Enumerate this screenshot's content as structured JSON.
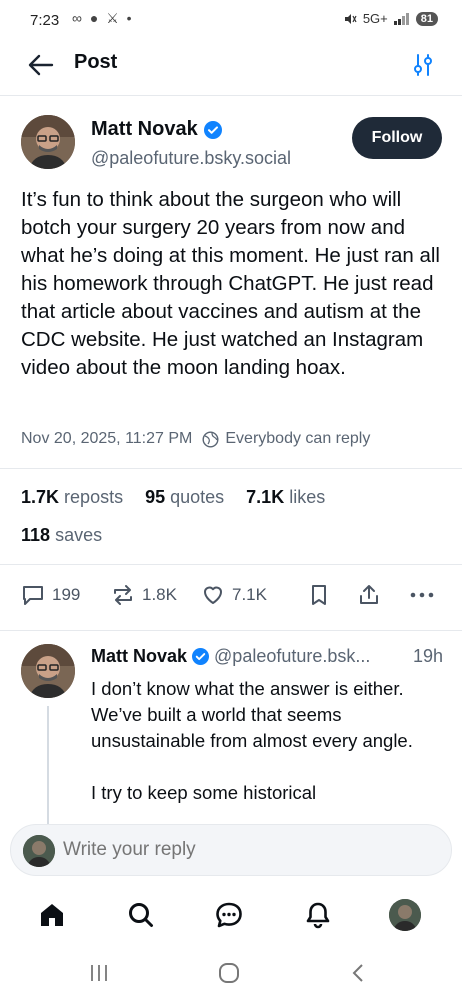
{
  "status_bar": {
    "time": "7:23",
    "left_icons": "∞ ● ⚔ •",
    "signal_text": "5G+",
    "battery": "81"
  },
  "header": {
    "title": "Post"
  },
  "post": {
    "author_name": "Matt Novak",
    "author_handle": "@paleofuture.bsky.social",
    "follow_label": "Follow",
    "text": "It’s fun to think about the surgeon who will botch your surgery 20 years from now and what he’s doing at this moment. He just ran all his homework through ChatGPT. He just read that article about vaccines and autism at the CDC website. He just watched an Instagram video about the moon landing hoax.",
    "timestamp": "Nov 20, 2025, 11:27 PM",
    "reply_setting": "Everybody can reply",
    "stats": {
      "reposts_count": "1.7K",
      "reposts_label": "reposts",
      "quotes_count": "95",
      "quotes_label": "quotes",
      "likes_count": "7.1K",
      "likes_label": "likes",
      "saves_count": "118",
      "saves_label": "saves"
    },
    "actions": {
      "replies": "199",
      "reposts": "1.8K",
      "likes": "7.1K"
    }
  },
  "reply": {
    "author_name": "Matt Novak",
    "author_handle": "@paleofuture.bsk...",
    "time": "19h",
    "text_line1": "I don’t know what the answer is either. We’ve built a world that seems unsustainable from almost every angle.",
    "text_line2": "I try to keep some historical"
  },
  "composer": {
    "placeholder": "Write your reply"
  },
  "colors": {
    "accent": "#1083fe",
    "follow_bg": "#1f2a38",
    "muted_text": "#5a6573"
  }
}
